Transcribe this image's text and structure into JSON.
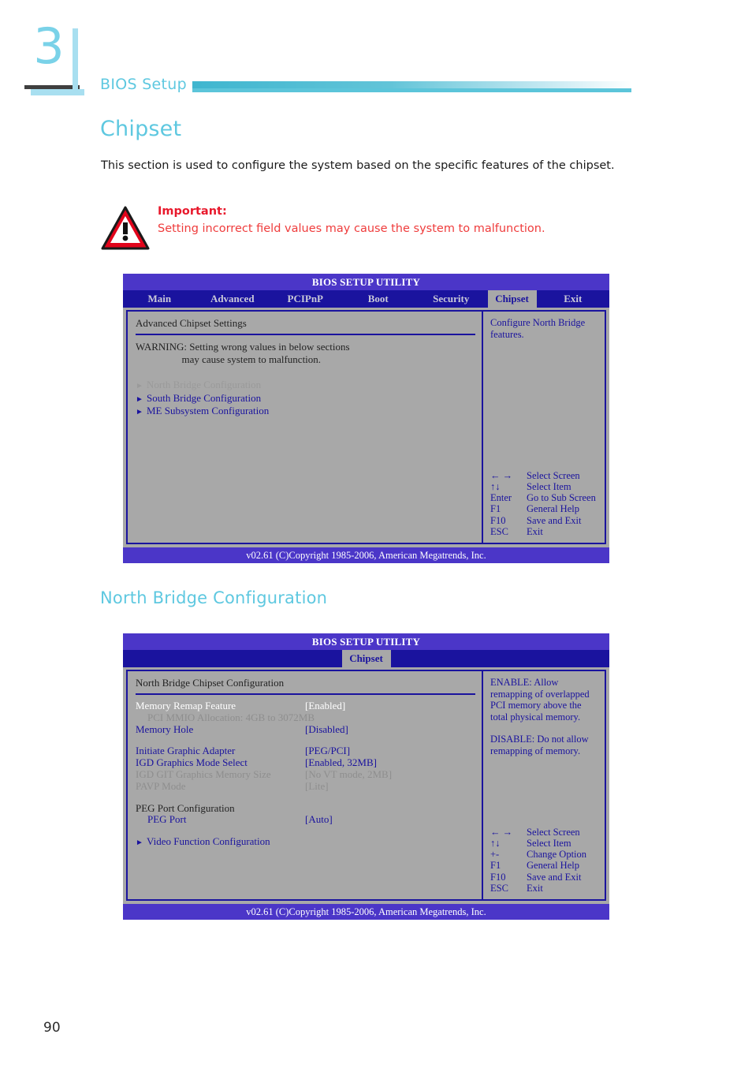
{
  "chapter": {
    "number": "3",
    "running_head": "BIOS Setup"
  },
  "page_number": "90",
  "section": {
    "title": "Chipset",
    "intro": "This section is used to configure the system based on the specific features of the chipset."
  },
  "important": {
    "icon": "warning-triangle-icon",
    "label": "Important:",
    "message": "Setting incorrect field values may cause the system to malfunction."
  },
  "subsection": {
    "title": "North Bridge Configuration"
  },
  "bios_screen_1": {
    "title": "BIOS SETUP UTILITY",
    "tabs": [
      {
        "label": "Main",
        "active": false
      },
      {
        "label": "Advanced",
        "active": false
      },
      {
        "label": "PCIPnP",
        "active": false
      },
      {
        "label": "Boot",
        "active": false
      },
      {
        "label": "Security",
        "active": false
      },
      {
        "label": "Chipset",
        "active": true
      },
      {
        "label": "Exit",
        "active": false
      }
    ],
    "panel_heading": "Advanced Chipset Settings",
    "warning_line_1": "WARNING: Setting wrong values in below sections",
    "warning_line_2": "                  may cause system to malfunction.",
    "menu_items": [
      {
        "label": "North Bridge Configuration",
        "selected": true
      },
      {
        "label": "South Bridge Configuration",
        "selected": false
      },
      {
        "label": "ME Subsystem Configuration",
        "selected": false
      }
    ],
    "help_text": "Configure North Bridge features.",
    "keys": [
      {
        "key": "← →",
        "desc": "Select Screen"
      },
      {
        "key": "↑↓",
        "desc": "Select Item"
      },
      {
        "key": "Enter",
        "desc": "Go to Sub Screen"
      },
      {
        "key": "F1",
        "desc": "General Help"
      },
      {
        "key": "F10",
        "desc": "Save and Exit"
      },
      {
        "key": "ESC",
        "desc": "Exit"
      }
    ],
    "footer": "v02.61 (C)Copyright 1985-2006, American Megatrends, Inc."
  },
  "bios_screen_2": {
    "title": "BIOS SETUP UTILITY",
    "tabs": [
      {
        "label": "Chipset",
        "active": true
      }
    ],
    "panel_heading": "North Bridge Chipset Configuration",
    "settings": [
      {
        "label": "Memory Remap Feature",
        "value": "[Enabled]",
        "state": "selected"
      },
      {
        "label": "PCI MMIO Allocation: 4GB to 3072MB",
        "value": "",
        "state": "dim",
        "indent": true
      },
      {
        "label": "Memory Hole",
        "value": "[Disabled]",
        "state": "normal"
      },
      {
        "label": "Initiate Graphic Adapter",
        "value": "[PEG/PCI]",
        "state": "normal"
      },
      {
        "label": "IGD Graphics Mode Select",
        "value": "[Enabled, 32MB]",
        "state": "normal"
      },
      {
        "label": "IGD GIT Graphics Memory Size",
        "value": "[No VT mode, 2MB]",
        "state": "dim"
      },
      {
        "label": "PAVP Mode",
        "value": "[Lite]",
        "state": "dim"
      },
      {
        "label": "PEG Port Configuration",
        "value": "",
        "state": "plain"
      },
      {
        "label": "PEG Port",
        "value": "[Auto]",
        "state": "normal",
        "indent": true
      },
      {
        "label": "Video Function Configuration",
        "value": "",
        "state": "submenu"
      }
    ],
    "help_paragraph_1": "ENABLE: Allow remapping of overlapped PCI memory above the total physical memory.",
    "help_paragraph_2": "DISABLE: Do not allow remapping of memory.",
    "keys": [
      {
        "key": "← →",
        "desc": "Select Screen"
      },
      {
        "key": "↑↓",
        "desc": "Select Item"
      },
      {
        "key": "+-",
        "desc": "Change Option"
      },
      {
        "key": "F1",
        "desc": "General Help"
      },
      {
        "key": "F10",
        "desc": "Save and Exit"
      },
      {
        "key": "ESC",
        "desc": "Exit"
      }
    ],
    "footer": "v02.61 (C)Copyright 1985-2006, American Megatrends, Inc."
  }
}
